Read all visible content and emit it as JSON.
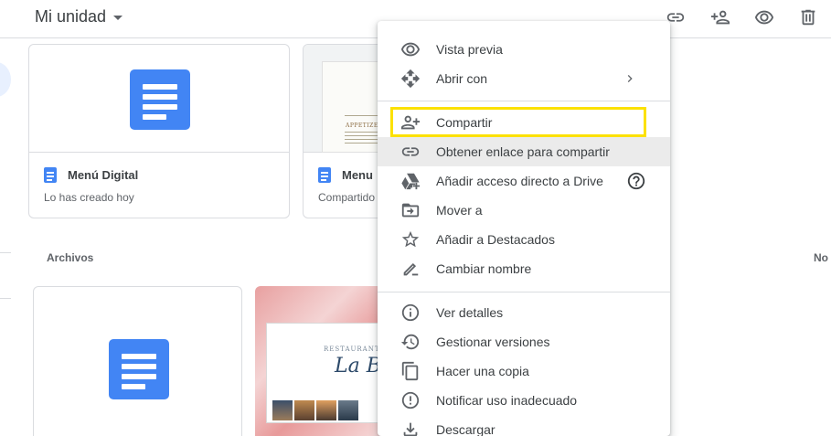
{
  "header": {
    "title": "Mi unidad",
    "icons": [
      "link-icon",
      "person-add-icon",
      "eye-icon",
      "trash-icon"
    ]
  },
  "cards": [
    {
      "name": "Menú Digital",
      "subtitle": "Lo has creado hoy"
    },
    {
      "name": "Menu",
      "subtitle": "Compartido"
    }
  ],
  "paper_thumb": {
    "heading": "APPETIZERS"
  },
  "sections": {
    "archivos_label": "Archivos",
    "right_label": "No"
  },
  "photo_card": {
    "brand": "RESTAURANTE",
    "script": "La Ba"
  },
  "context_menu": {
    "items": [
      {
        "label": "Vista previa",
        "icon": "eye-icon"
      },
      {
        "label": "Abrir con",
        "icon": "move-icon",
        "submenu_icon": "chevron-right-icon"
      },
      {
        "label": "Compartir",
        "icon": "person-add-icon",
        "highlighted": true
      },
      {
        "label": "Obtener enlace para compartir",
        "icon": "link-icon",
        "hovered": true
      },
      {
        "label": "Añadir acceso directo a Drive",
        "icon": "drive-shortcut-icon",
        "help_icon": "help-circle-icon"
      },
      {
        "label": "Mover a",
        "icon": "folder-move-icon"
      },
      {
        "label": "Añadir a Destacados",
        "icon": "star-outline-icon"
      },
      {
        "label": "Cambiar nombre",
        "icon": "pencil-icon"
      },
      {
        "label": "Ver detalles",
        "icon": "info-icon"
      },
      {
        "label": "Gestionar versiones",
        "icon": "history-icon"
      },
      {
        "label": "Hacer una copia",
        "icon": "copy-icon"
      },
      {
        "label": "Notificar uso inadecuado",
        "icon": "report-icon"
      },
      {
        "label": "Descargar",
        "icon": "download-icon"
      }
    ]
  },
  "colors": {
    "doc_blue": "#4285f4",
    "highlight_yellow": "#fce100",
    "hover_gray": "#ebebeb"
  }
}
